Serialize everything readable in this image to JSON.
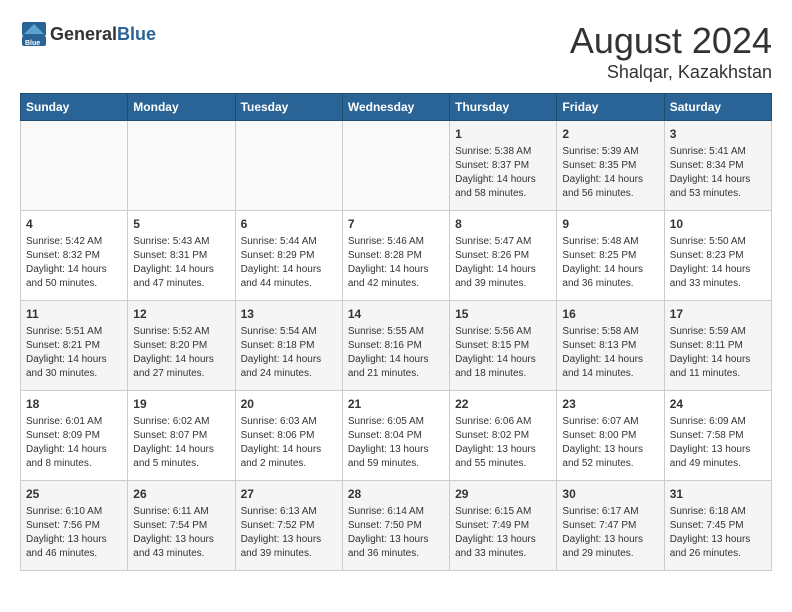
{
  "header": {
    "logo_general": "General",
    "logo_blue": "Blue",
    "month_year": "August 2024",
    "location": "Shalqar, Kazakhstan"
  },
  "days_of_week": [
    "Sunday",
    "Monday",
    "Tuesday",
    "Wednesday",
    "Thursday",
    "Friday",
    "Saturday"
  ],
  "weeks": [
    [
      {
        "day": "",
        "info": ""
      },
      {
        "day": "",
        "info": ""
      },
      {
        "day": "",
        "info": ""
      },
      {
        "day": "",
        "info": ""
      },
      {
        "day": "1",
        "info": "Sunrise: 5:38 AM\nSunset: 8:37 PM\nDaylight: 14 hours\nand 58 minutes."
      },
      {
        "day": "2",
        "info": "Sunrise: 5:39 AM\nSunset: 8:35 PM\nDaylight: 14 hours\nand 56 minutes."
      },
      {
        "day": "3",
        "info": "Sunrise: 5:41 AM\nSunset: 8:34 PM\nDaylight: 14 hours\nand 53 minutes."
      }
    ],
    [
      {
        "day": "4",
        "info": "Sunrise: 5:42 AM\nSunset: 8:32 PM\nDaylight: 14 hours\nand 50 minutes."
      },
      {
        "day": "5",
        "info": "Sunrise: 5:43 AM\nSunset: 8:31 PM\nDaylight: 14 hours\nand 47 minutes."
      },
      {
        "day": "6",
        "info": "Sunrise: 5:44 AM\nSunset: 8:29 PM\nDaylight: 14 hours\nand 44 minutes."
      },
      {
        "day": "7",
        "info": "Sunrise: 5:46 AM\nSunset: 8:28 PM\nDaylight: 14 hours\nand 42 minutes."
      },
      {
        "day": "8",
        "info": "Sunrise: 5:47 AM\nSunset: 8:26 PM\nDaylight: 14 hours\nand 39 minutes."
      },
      {
        "day": "9",
        "info": "Sunrise: 5:48 AM\nSunset: 8:25 PM\nDaylight: 14 hours\nand 36 minutes."
      },
      {
        "day": "10",
        "info": "Sunrise: 5:50 AM\nSunset: 8:23 PM\nDaylight: 14 hours\nand 33 minutes."
      }
    ],
    [
      {
        "day": "11",
        "info": "Sunrise: 5:51 AM\nSunset: 8:21 PM\nDaylight: 14 hours\nand 30 minutes."
      },
      {
        "day": "12",
        "info": "Sunrise: 5:52 AM\nSunset: 8:20 PM\nDaylight: 14 hours\nand 27 minutes."
      },
      {
        "day": "13",
        "info": "Sunrise: 5:54 AM\nSunset: 8:18 PM\nDaylight: 14 hours\nand 24 minutes."
      },
      {
        "day": "14",
        "info": "Sunrise: 5:55 AM\nSunset: 8:16 PM\nDaylight: 14 hours\nand 21 minutes."
      },
      {
        "day": "15",
        "info": "Sunrise: 5:56 AM\nSunset: 8:15 PM\nDaylight: 14 hours\nand 18 minutes."
      },
      {
        "day": "16",
        "info": "Sunrise: 5:58 AM\nSunset: 8:13 PM\nDaylight: 14 hours\nand 14 minutes."
      },
      {
        "day": "17",
        "info": "Sunrise: 5:59 AM\nSunset: 8:11 PM\nDaylight: 14 hours\nand 11 minutes."
      }
    ],
    [
      {
        "day": "18",
        "info": "Sunrise: 6:01 AM\nSunset: 8:09 PM\nDaylight: 14 hours\nand 8 minutes."
      },
      {
        "day": "19",
        "info": "Sunrise: 6:02 AM\nSunset: 8:07 PM\nDaylight: 14 hours\nand 5 minutes."
      },
      {
        "day": "20",
        "info": "Sunrise: 6:03 AM\nSunset: 8:06 PM\nDaylight: 14 hours\nand 2 minutes."
      },
      {
        "day": "21",
        "info": "Sunrise: 6:05 AM\nSunset: 8:04 PM\nDaylight: 13 hours\nand 59 minutes."
      },
      {
        "day": "22",
        "info": "Sunrise: 6:06 AM\nSunset: 8:02 PM\nDaylight: 13 hours\nand 55 minutes."
      },
      {
        "day": "23",
        "info": "Sunrise: 6:07 AM\nSunset: 8:00 PM\nDaylight: 13 hours\nand 52 minutes."
      },
      {
        "day": "24",
        "info": "Sunrise: 6:09 AM\nSunset: 7:58 PM\nDaylight: 13 hours\nand 49 minutes."
      }
    ],
    [
      {
        "day": "25",
        "info": "Sunrise: 6:10 AM\nSunset: 7:56 PM\nDaylight: 13 hours\nand 46 minutes."
      },
      {
        "day": "26",
        "info": "Sunrise: 6:11 AM\nSunset: 7:54 PM\nDaylight: 13 hours\nand 43 minutes."
      },
      {
        "day": "27",
        "info": "Sunrise: 6:13 AM\nSunset: 7:52 PM\nDaylight: 13 hours\nand 39 minutes."
      },
      {
        "day": "28",
        "info": "Sunrise: 6:14 AM\nSunset: 7:50 PM\nDaylight: 13 hours\nand 36 minutes."
      },
      {
        "day": "29",
        "info": "Sunrise: 6:15 AM\nSunset: 7:49 PM\nDaylight: 13 hours\nand 33 minutes."
      },
      {
        "day": "30",
        "info": "Sunrise: 6:17 AM\nSunset: 7:47 PM\nDaylight: 13 hours\nand 29 minutes."
      },
      {
        "day": "31",
        "info": "Sunrise: 6:18 AM\nSunset: 7:45 PM\nDaylight: 13 hours\nand 26 minutes."
      }
    ]
  ]
}
